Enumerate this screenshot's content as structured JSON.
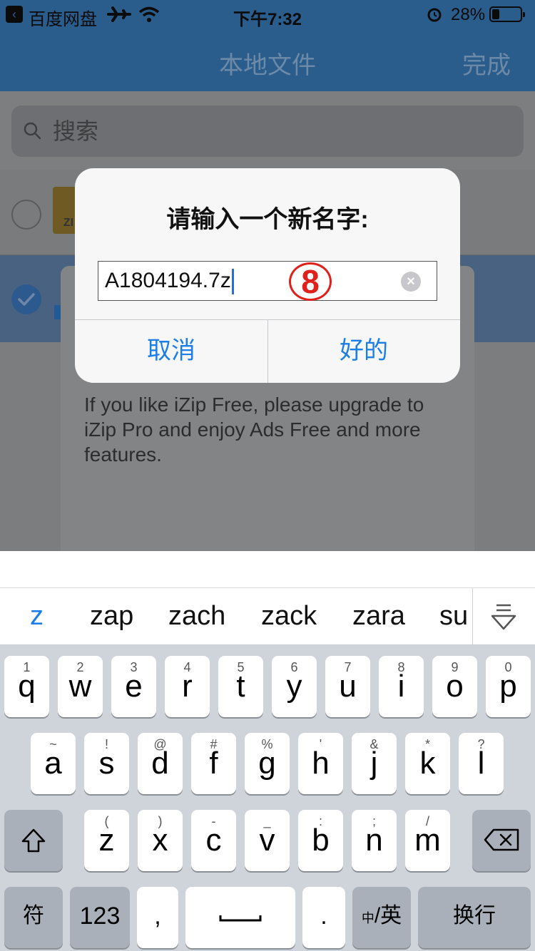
{
  "status": {
    "carrier": "百度网盘",
    "time": "下午7:32",
    "battery": "28%"
  },
  "nav": {
    "title": "本地文件",
    "done": "完成"
  },
  "search": {
    "placeholder": "搜索"
  },
  "list": {
    "zip_label": "ZI"
  },
  "ad": {
    "text": "If you like iZip Free, please  upgrade to iZip Pro and enjoy Ads Free and more features."
  },
  "alert": {
    "title": "请输入一个新名字:",
    "input_value": "A1804194.7z",
    "annotation": "8",
    "cancel": "取消",
    "ok": "好的"
  },
  "suggestions": [
    "z",
    "zap",
    "zach",
    "zack",
    "zara",
    "su"
  ],
  "keyboard": {
    "row1": [
      {
        "k": "q",
        "h": "1"
      },
      {
        "k": "w",
        "h": "2"
      },
      {
        "k": "e",
        "h": "3"
      },
      {
        "k": "r",
        "h": "4"
      },
      {
        "k": "t",
        "h": "5"
      },
      {
        "k": "y",
        "h": "6"
      },
      {
        "k": "u",
        "h": "7"
      },
      {
        "k": "i",
        "h": "8"
      },
      {
        "k": "o",
        "h": "9"
      },
      {
        "k": "p",
        "h": "0"
      }
    ],
    "row2": [
      {
        "k": "a",
        "h": "~"
      },
      {
        "k": "s",
        "h": "!"
      },
      {
        "k": "d",
        "h": "@"
      },
      {
        "k": "f",
        "h": "#"
      },
      {
        "k": "g",
        "h": "%"
      },
      {
        "k": "h",
        "h": "'"
      },
      {
        "k": "j",
        "h": "&"
      },
      {
        "k": "k",
        "h": "*"
      },
      {
        "k": "l",
        "h": "?"
      }
    ],
    "row3": [
      {
        "k": "z",
        "h": "("
      },
      {
        "k": "x",
        "h": ")"
      },
      {
        "k": "c",
        "h": "-"
      },
      {
        "k": "v",
        "h": "_"
      },
      {
        "k": "b",
        "h": ":"
      },
      {
        "k": "n",
        "h": ";"
      },
      {
        "k": "m",
        "h": "/"
      }
    ],
    "symbols": "符",
    "numbers": "123",
    "comma": ",",
    "period": ".",
    "lang_small": "中",
    "lang_big": "/英",
    "return": "换行"
  }
}
